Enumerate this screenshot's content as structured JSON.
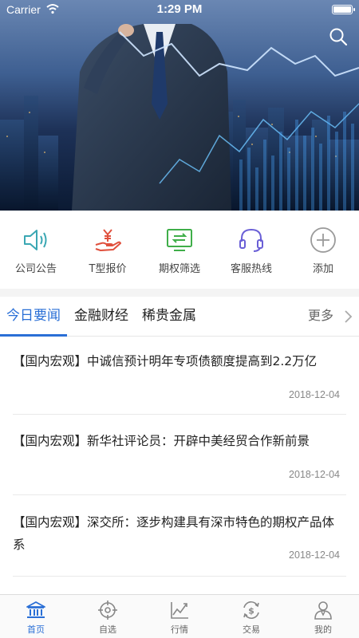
{
  "status_bar": {
    "carrier": "Carrier",
    "time": "1:29 PM"
  },
  "hero": {
    "search_icon": "search-icon"
  },
  "quick_actions": [
    {
      "label": "公司公告",
      "icon": "speaker-icon",
      "color": "#3aa7b3"
    },
    {
      "label": "T型报价",
      "icon": "hand-yen-icon",
      "color": "#e0503d"
    },
    {
      "label": "期权筛选",
      "icon": "monitor-icon",
      "color": "#3fae49"
    },
    {
      "label": "客服热线",
      "icon": "headset-icon",
      "color": "#6a5fd6"
    },
    {
      "label": "添加",
      "icon": "plus-circle-icon",
      "color": "#9a9a9a"
    }
  ],
  "tabs": [
    {
      "label": "今日要闻",
      "active": true
    },
    {
      "label": "金融财经",
      "active": false
    },
    {
      "label": "稀贵金属",
      "active": false
    }
  ],
  "more_label": "更多",
  "news": [
    {
      "title": "【国内宏观】中诚信预计明年专项债额度提高到2.2万亿",
      "date": "2018-12-04"
    },
    {
      "title": "【国内宏观】新华社评论员：开辟中美经贸合作新前景",
      "date": "2018-12-04"
    },
    {
      "title": "【国内宏观】深交所：逐步构建具有深市特色的期权产品体系",
      "date": "2018-12-04"
    }
  ],
  "bottom_tabs": [
    {
      "label": "首页",
      "icon": "bank-icon",
      "active": true
    },
    {
      "label": "自选",
      "icon": "target-icon",
      "active": false
    },
    {
      "label": "行情",
      "icon": "chart-icon",
      "active": false
    },
    {
      "label": "交易",
      "icon": "dollar-cycle-icon",
      "active": false
    },
    {
      "label": "我的",
      "icon": "user-icon",
      "active": false
    }
  ],
  "colors": {
    "accent": "#2a6fd6",
    "inactive_icon": "#888888"
  }
}
